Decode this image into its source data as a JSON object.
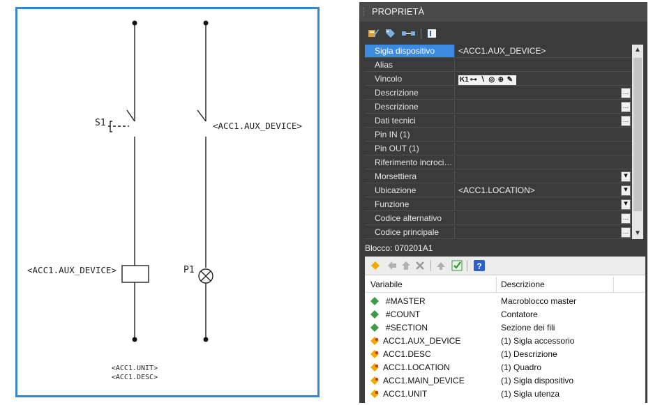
{
  "schematic": {
    "labels": {
      "s1": "S1",
      "aux_device_top": "<ACC1.AUX_DEVICE>",
      "aux_device_coil": "<ACC1.AUX_DEVICE>",
      "p1": "P1",
      "unit": "<ACC1.UNIT>",
      "desc": "<ACC1.DESC>"
    }
  },
  "panel": {
    "title": "PROPRIETÀ",
    "toolbar_icons": [
      "properties-icon",
      "tag-icon",
      "link-icon",
      "edit-icon"
    ],
    "properties": [
      {
        "key": "Sigla dispositivo",
        "value": "<ACC1.AUX_DEVICE>",
        "control": "",
        "selected": true
      },
      {
        "key": "Alias",
        "value": "",
        "control": ""
      },
      {
        "key": "Vincolo",
        "value": "",
        "control": "symbols"
      },
      {
        "key": "Descrizione",
        "value": "",
        "control": "ellipsis"
      },
      {
        "key": "Descrizione",
        "value": "",
        "control": "ellipsis"
      },
      {
        "key": "Dati tecnici",
        "value": "",
        "control": "ellipsis"
      },
      {
        "key": "Pin IN (1)",
        "value": "",
        "control": ""
      },
      {
        "key": "Pin OUT (1)",
        "value": "",
        "control": ""
      },
      {
        "key": "Riferimento incroci…",
        "value": "",
        "control": ""
      },
      {
        "key": "Morsettiera",
        "value": "",
        "control": "dropdown"
      },
      {
        "key": "Ubicazione",
        "value": "<ACC1.LOCATION>",
        "control": "dropdown"
      },
      {
        "key": "Funzione",
        "value": "",
        "control": "dropdown"
      },
      {
        "key": "Codice alternativo",
        "value": "",
        "control": "ellipsis"
      },
      {
        "key": "Codice principale",
        "value": "",
        "control": "ellipsis"
      }
    ],
    "vincolo_symbols": [
      "K1",
      "⊶",
      "∖",
      "◎",
      "⊕",
      "✎"
    ],
    "block_label": "Blocco: 070201A1",
    "variables_header": {
      "name": "Variabile",
      "description": "Descrizione"
    },
    "variables": [
      {
        "name": "#MASTER",
        "description": "Macroblocco master",
        "icon": "green-diamond-icon"
      },
      {
        "name": "#COUNT",
        "description": "Contatore",
        "icon": "green-diamond-icon"
      },
      {
        "name": "#SECTION",
        "description": "Sezione dei fili",
        "icon": "green-diamond-icon"
      },
      {
        "name": "ACC1.AUX_DEVICE",
        "description": "(1) Sigla accessorio",
        "icon": "yellow-diamond-icon"
      },
      {
        "name": "ACC1.DESC",
        "description": "(1) Descrizione",
        "icon": "yellow-diamond-icon"
      },
      {
        "name": "ACC1.LOCATION",
        "description": "(1) Quadro",
        "icon": "yellow-diamond-icon"
      },
      {
        "name": "ACC1.MAIN_DEVICE",
        "description": "(1) Sigla dispositivo",
        "icon": "yellow-diamond-icon"
      },
      {
        "name": "ACC1.UNIT",
        "description": "(1) Sigla utenza",
        "icon": "yellow-diamond-icon"
      }
    ],
    "colors": {
      "selection": "#3d8be0",
      "panel_bg": "#3b3b3b",
      "frame_border": "#3a86cc"
    }
  }
}
